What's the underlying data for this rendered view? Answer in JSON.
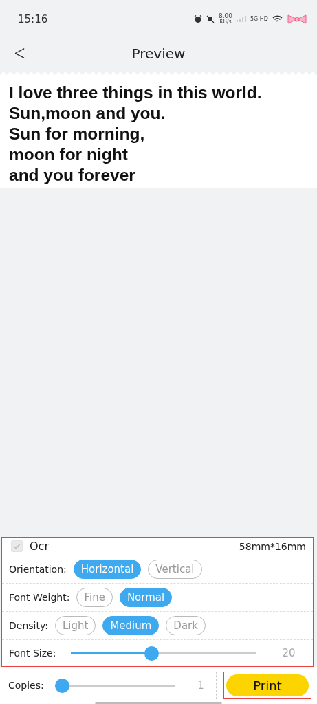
{
  "status_bar": {
    "time": "15:16",
    "speed_value": "8.00",
    "speed_unit": "KB/s",
    "network": "5G HD"
  },
  "header": {
    "back_icon": "<",
    "title": "Preview"
  },
  "preview": {
    "lines": [
      "I love three things in this world.",
      "Sun,moon and you.",
      "Sun for morning,",
      "moon for night",
      "and you forever"
    ]
  },
  "settings": {
    "ocr": {
      "label": "Ocr",
      "checked": true,
      "disabled": true
    },
    "paper_size": "58mm*16mm",
    "options": [
      {
        "label": "Orientation:",
        "choices": [
          {
            "label": "Horizontal",
            "selected": true
          },
          {
            "label": "Vertical",
            "selected": false
          }
        ]
      },
      {
        "label": "Font Weight:",
        "choices": [
          {
            "label": "Fine",
            "selected": false
          },
          {
            "label": "Normal",
            "selected": true
          }
        ]
      },
      {
        "label": "Density:",
        "choices": [
          {
            "label": "Light",
            "selected": false
          },
          {
            "label": "Medium",
            "selected": true
          },
          {
            "label": "Dark",
            "selected": false
          }
        ]
      }
    ],
    "font_size": {
      "label": "Font Size:",
      "level": 0.43,
      "reading": "20"
    }
  },
  "footer": {
    "copies": {
      "label": "Copies:",
      "level": 0,
      "reading": "1"
    },
    "print_button": "Print"
  }
}
